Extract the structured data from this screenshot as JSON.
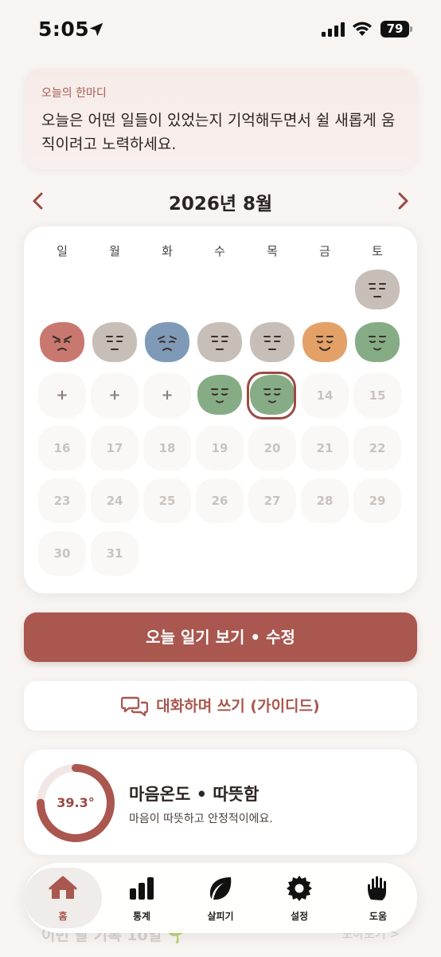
{
  "status_bar": {
    "time": "5:05",
    "battery": "79"
  },
  "quote": {
    "label": "오늘의 한마디",
    "text": "오늘은 어떤 일들이 있었는지 기억해두면서 쉴 새롭게 움직이려고 노력하세요."
  },
  "calendar": {
    "month_title": "2026년 8월",
    "weekdays": [
      "일",
      "월",
      "화",
      "수",
      "목",
      "금",
      "토"
    ],
    "plus_label": "+",
    "mood_days": [
      {
        "day": 1,
        "mood": "neutral",
        "color": "#c7bfb7"
      },
      {
        "day": 2,
        "mood": "angry",
        "color": "#c9786f"
      },
      {
        "day": 3,
        "mood": "neutral",
        "color": "#c7bfb7"
      },
      {
        "day": 4,
        "mood": "sad",
        "color": "#7e9ab7"
      },
      {
        "day": 5,
        "mood": "neutral",
        "color": "#c7bfb7"
      },
      {
        "day": 6,
        "mood": "neutral",
        "color": "#c7bfb7"
      },
      {
        "day": 7,
        "mood": "happy",
        "color": "#e3a067"
      },
      {
        "day": 8,
        "mood": "calm",
        "color": "#86ac86"
      },
      {
        "day": 12,
        "mood": "calm",
        "color": "#86ac86"
      },
      {
        "day": 13,
        "mood": "calm",
        "color": "#86ac86",
        "today": true
      }
    ],
    "empty_days_with_plus": [
      9,
      10,
      11
    ],
    "future_days": [
      "14",
      "15",
      "16",
      "17",
      "18",
      "19",
      "20",
      "21",
      "22",
      "23",
      "24",
      "25",
      "26",
      "27",
      "28",
      "29",
      "30",
      "31"
    ]
  },
  "buttons": {
    "primary_label": "오늘 일기 보기 • 수정",
    "guided_label": "대화하며 쓰기 (가이디드)"
  },
  "temperature": {
    "value": "39.3°",
    "title": "마음온도 • 따뜻함",
    "description": "마음이 따뜻하고 안정적이에요.",
    "fill_fraction": 0.75,
    "accent": "#a9574f"
  },
  "peek": {
    "text": "이번 달 기록 10일 🌱",
    "link": "모아보기 >"
  },
  "tabs": [
    {
      "label": "홈",
      "icon": "home-icon",
      "active": true
    },
    {
      "label": "통계",
      "icon": "bar-chart-icon",
      "active": false
    },
    {
      "label": "살피기",
      "icon": "leaf-icon",
      "active": false
    },
    {
      "label": "설정",
      "icon": "gear-icon",
      "active": false
    },
    {
      "label": "도움",
      "icon": "hand-icon",
      "active": false
    }
  ]
}
